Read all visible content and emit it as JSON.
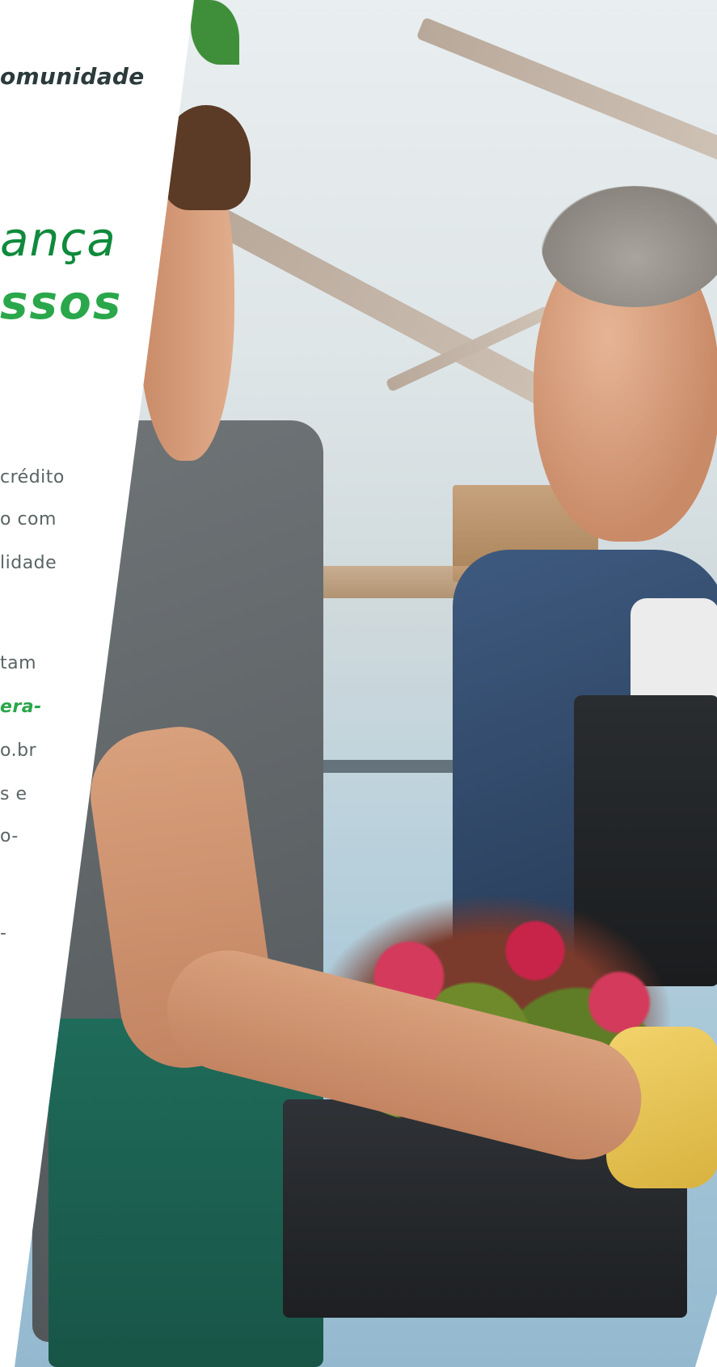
{
  "kicker": "omunidade",
  "headline": {
    "line1": "ança",
    "line2": "ssos"
  },
  "body": {
    "p1": [
      "crédito",
      "o com",
      "lidade"
    ],
    "p2": [
      "tam",
      "era-",
      "o.br",
      "s e",
      "o-",
      "-"
    ]
  },
  "colors": {
    "green_dark": "#0f8a3c",
    "green_light": "#2aa74a",
    "text_gray": "#5a6464",
    "kicker_dark": "#2b3a3a"
  }
}
